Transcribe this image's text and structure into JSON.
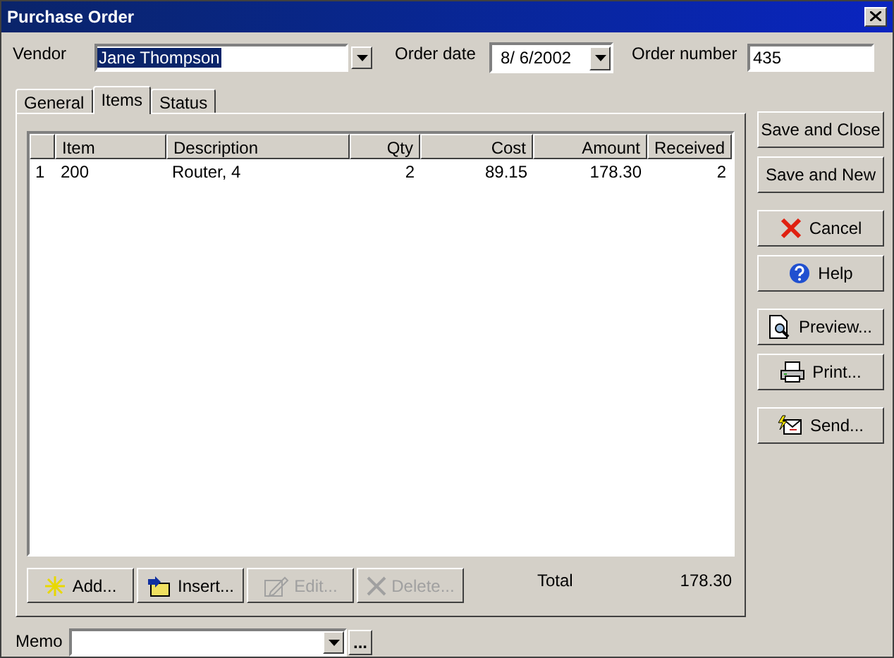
{
  "window": {
    "title": "Purchase Order"
  },
  "header": {
    "vendor_label": "Vendor",
    "vendor": "Jane Thompson",
    "date_label": "Order date",
    "date": "8/ 6/2002",
    "number_label": "Order number",
    "number": "435"
  },
  "tabs": [
    {
      "label": "General",
      "selected": false
    },
    {
      "label": "Items",
      "selected": true
    },
    {
      "label": "Status",
      "selected": false
    }
  ],
  "table": {
    "columns": [
      "",
      "Item",
      "Description",
      "Qty",
      "Cost",
      "Amount",
      "Received"
    ],
    "rows": [
      [
        "1",
        "200",
        "Router, 4",
        "2",
        "89.15",
        "178.30",
        "2"
      ]
    ]
  },
  "item_buttons": [
    {
      "label": "Add...",
      "kind": "add",
      "disabled": false
    },
    {
      "label": "Insert...",
      "kind": "insert",
      "disabled": false
    },
    {
      "label": "Edit...",
      "kind": "edit",
      "disabled": true
    },
    {
      "label": "Delete...",
      "kind": "delete",
      "disabled": true
    }
  ],
  "total": {
    "label": "Total",
    "value": "178.30"
  },
  "memo": {
    "label": "Memo",
    "more": "..."
  },
  "side_button_groups": [
    [
      {
        "label": "Save and Close",
        "kind": "plain"
      },
      {
        "label": "Save and New",
        "kind": "plain"
      }
    ],
    [
      {
        "label": "Cancel",
        "kind": "cancel"
      },
      {
        "label": "Help",
        "kind": "help"
      }
    ],
    [
      {
        "label": "Preview...",
        "kind": "preview"
      },
      {
        "label": "Print...",
        "kind": "print"
      }
    ],
    [
      {
        "label": "Send...",
        "kind": "send"
      }
    ]
  ]
}
